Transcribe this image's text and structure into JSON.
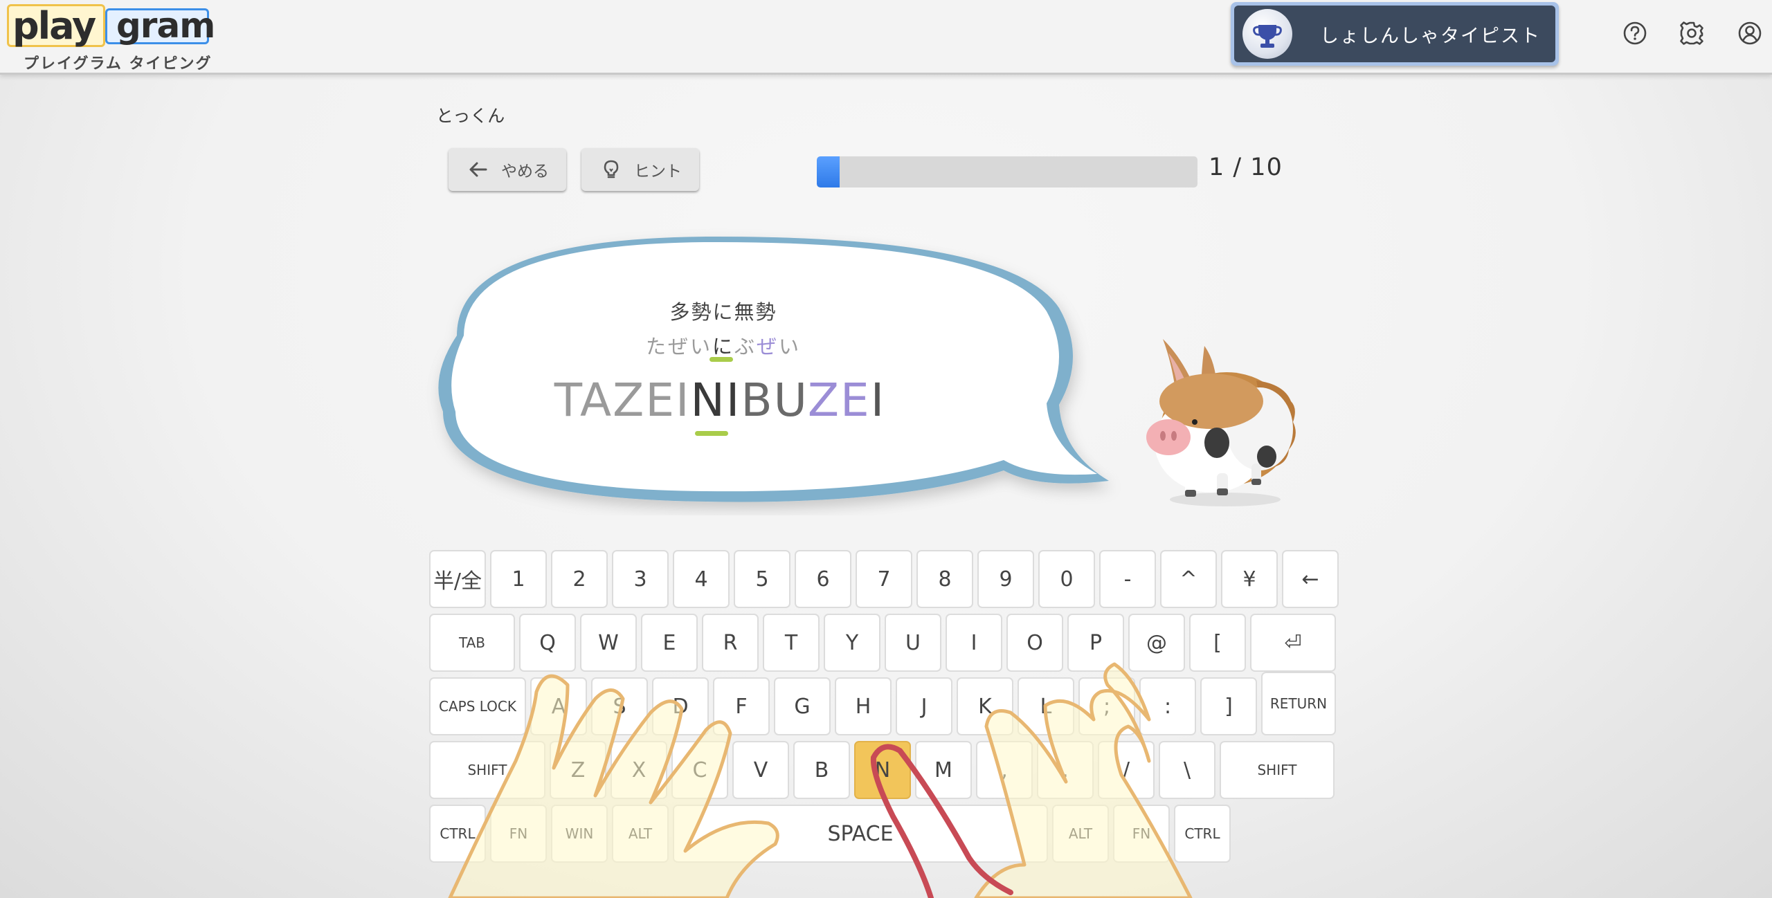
{
  "header": {
    "logo_word1": "play",
    "logo_word2": "gram",
    "logo_subtitle": "プレイグラム タイピング",
    "rank_label": "しょしんしゃタイピスト",
    "icons": [
      "help-icon",
      "settings-gear-icon",
      "account-icon"
    ]
  },
  "practice": {
    "mode_title": "とっくん",
    "quit_button": "やめる",
    "hint_button": "ヒント",
    "progress": {
      "current": 1,
      "total": 10,
      "label": "1 / 10"
    }
  },
  "prompt": {
    "kanji": "多勢に無勢",
    "kana_parts": [
      "たぜい",
      "に",
      "ぶ",
      "ぜ",
      "い"
    ],
    "romaji_parts": [
      "TAZEI",
      "NI",
      "BU",
      "ZE",
      "I"
    ]
  },
  "keyboard": {
    "rows": [
      [
        "半/全",
        "1",
        "2",
        "3",
        "4",
        "5",
        "6",
        "7",
        "8",
        "9",
        "0",
        "-",
        "^",
        "¥",
        "←"
      ],
      [
        "TAB",
        "Q",
        "W",
        "E",
        "R",
        "T",
        "Y",
        "U",
        "I",
        "O",
        "P",
        "@",
        "[",
        "⏎"
      ],
      [
        "CAPS LOCK",
        "A",
        "S",
        "D",
        "F",
        "G",
        "H",
        "J",
        "K",
        "L",
        ";",
        ":",
        "]",
        "RETURN"
      ],
      [
        "SHIFT",
        "Z",
        "X",
        "C",
        "V",
        "B",
        "N",
        "M",
        ",",
        ".",
        "/",
        "\\",
        "SHIFT"
      ],
      [
        "CTRL",
        "FN",
        "WIN",
        "ALT",
        "SPACE",
        "ALT",
        "FN",
        "CTRL"
      ]
    ],
    "highlighted_key": "N"
  },
  "colors": {
    "progress_fill": "#3b86f0",
    "highlight_key": "#f2c55a",
    "romaji_highlight": "#9b8dd6",
    "underline": "#a9cc4a",
    "bubble_edge": "#7fb0cc",
    "rank_badge": "#3c4a5e"
  }
}
